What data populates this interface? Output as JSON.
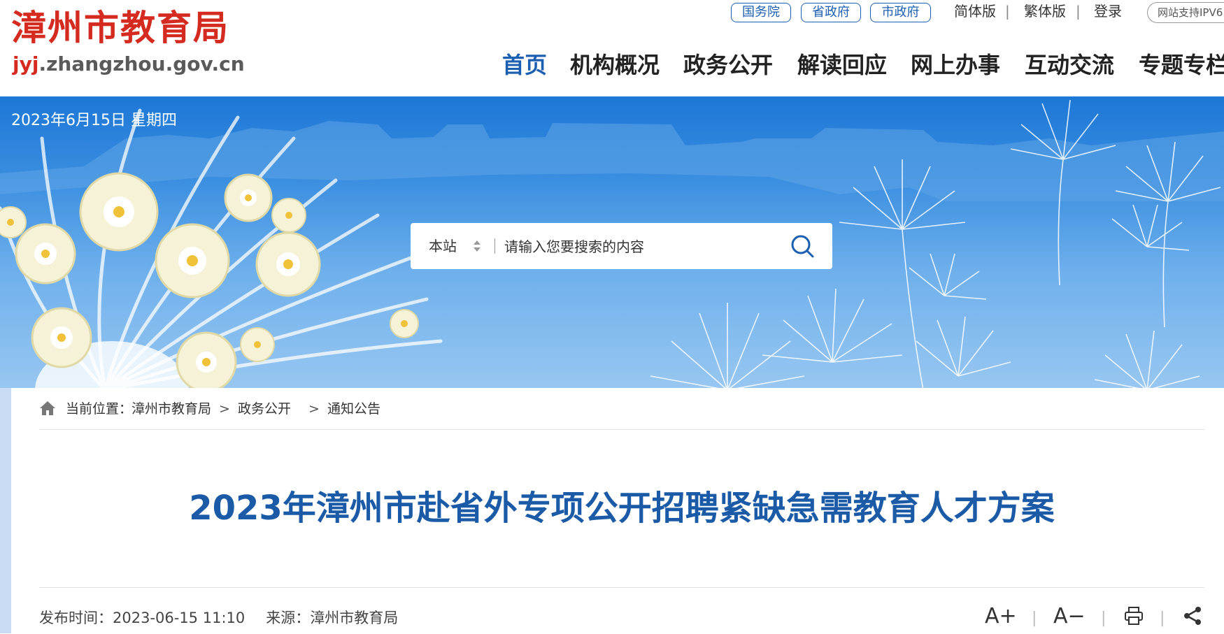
{
  "header": {
    "logo_cn": "漳州市教育局",
    "logo_url_red": "jyj",
    "logo_url_rest": ".zhangzhou.gov.cn",
    "gov_links": [
      "国务院",
      "省政府",
      "市政府"
    ],
    "lang_links": [
      "简体版",
      "繁体版",
      "登录"
    ],
    "ipv6_label": "网站支持IPV6",
    "nav": [
      "首页",
      "机构概况",
      "政务公开",
      "解读回应",
      "网上办事",
      "互动交流",
      "专题专栏"
    ],
    "active_nav": "首页",
    "accent_color": "#1c5fb1",
    "logo_color": "#d42a1f"
  },
  "banner": {
    "date": "2023年6月15日 星期四",
    "search": {
      "scope": "本站",
      "placeholder": "请输入您要搜索的内容",
      "search_icon": "search-icon"
    }
  },
  "breadcrumb": {
    "prefix": "当前位置：",
    "items": [
      "漳州市教育局",
      "政务公开",
      "通知公告"
    ],
    "separator": ">",
    "home_icon": "home-icon"
  },
  "article": {
    "title": "2023年漳州市赴省外专项公开招聘紧缺急需教育人才方案",
    "publish_label": "发布时间：",
    "publish_time": "2023-06-15 11:10",
    "source_label": "来源：",
    "source": "漳州市教育局",
    "title_color": "#1a5aa6"
  },
  "tools": {
    "font_increase": "A+",
    "font_decrease": "A−",
    "print_icon": "print-icon",
    "share_icon": "share-icon"
  }
}
